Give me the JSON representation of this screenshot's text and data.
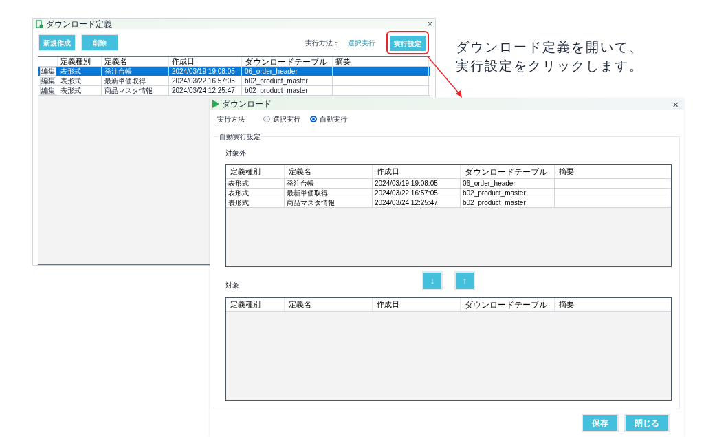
{
  "back_window": {
    "title": "ダウンロード定義",
    "close_glyph": "×",
    "buttons": [
      "新規作成",
      "削除"
    ],
    "mode_label": "実行方法：",
    "mode_value": "選択実行",
    "settings_button": "実行設定",
    "table": {
      "columns": [
        "定義種別",
        "定義名",
        "作成日",
        "ダウンロードテーブル",
        "摘要"
      ],
      "rows": [
        {
          "action": "編集",
          "cells": [
            "表形式",
            "発注台帳",
            "2024/03/19 19:08:05",
            "06_order_header",
            ""
          ],
          "selected": true
        },
        {
          "action": "編集",
          "cells": [
            "表形式",
            "最新単価取得",
            "2024/03/22 16:57:05",
            "b02_product_master",
            ""
          ],
          "selected": false
        },
        {
          "action": "編集",
          "cells": [
            "表形式",
            "商品マスタ情報",
            "2024/03/24 12:25:47",
            "b02_product_master",
            ""
          ],
          "selected": false
        }
      ]
    }
  },
  "annotation": {
    "lines": [
      "ダウンロード定義を開いて、",
      "実行設定をクリックします。"
    ]
  },
  "front_window": {
    "title": "ダウンロード",
    "close_glyph": "×",
    "mode_label": "実行方法",
    "mode_options": [
      {
        "label": "選択実行",
        "selected": false
      },
      {
        "label": "自動実行",
        "selected": true
      }
    ],
    "group_title": "自動実行設定",
    "excluded": {
      "label": "対象外",
      "columns": [
        "定義種別",
        "定義名",
        "作成日",
        "ダウンロードテーブル",
        "摘要"
      ],
      "rows": [
        [
          "表形式",
          "発注台帳",
          "2024/03/19 19:08:05",
          "06_order_header",
          ""
        ],
        [
          "表形式",
          "最新単価取得",
          "2024/03/22 16:57:05",
          "b02_product_master",
          ""
        ],
        [
          "表形式",
          "商品マスタ情報",
          "2024/03/24 12:25:47",
          "b02_product_master",
          ""
        ]
      ]
    },
    "move_buttons": [
      "↓",
      "↑"
    ],
    "included": {
      "label": "対象",
      "columns": [
        "定義種別",
        "定義名",
        "作成日",
        "ダウンロードテーブル",
        "摘要"
      ]
    },
    "footer_buttons": [
      "保存",
      "閉じる"
    ]
  }
}
